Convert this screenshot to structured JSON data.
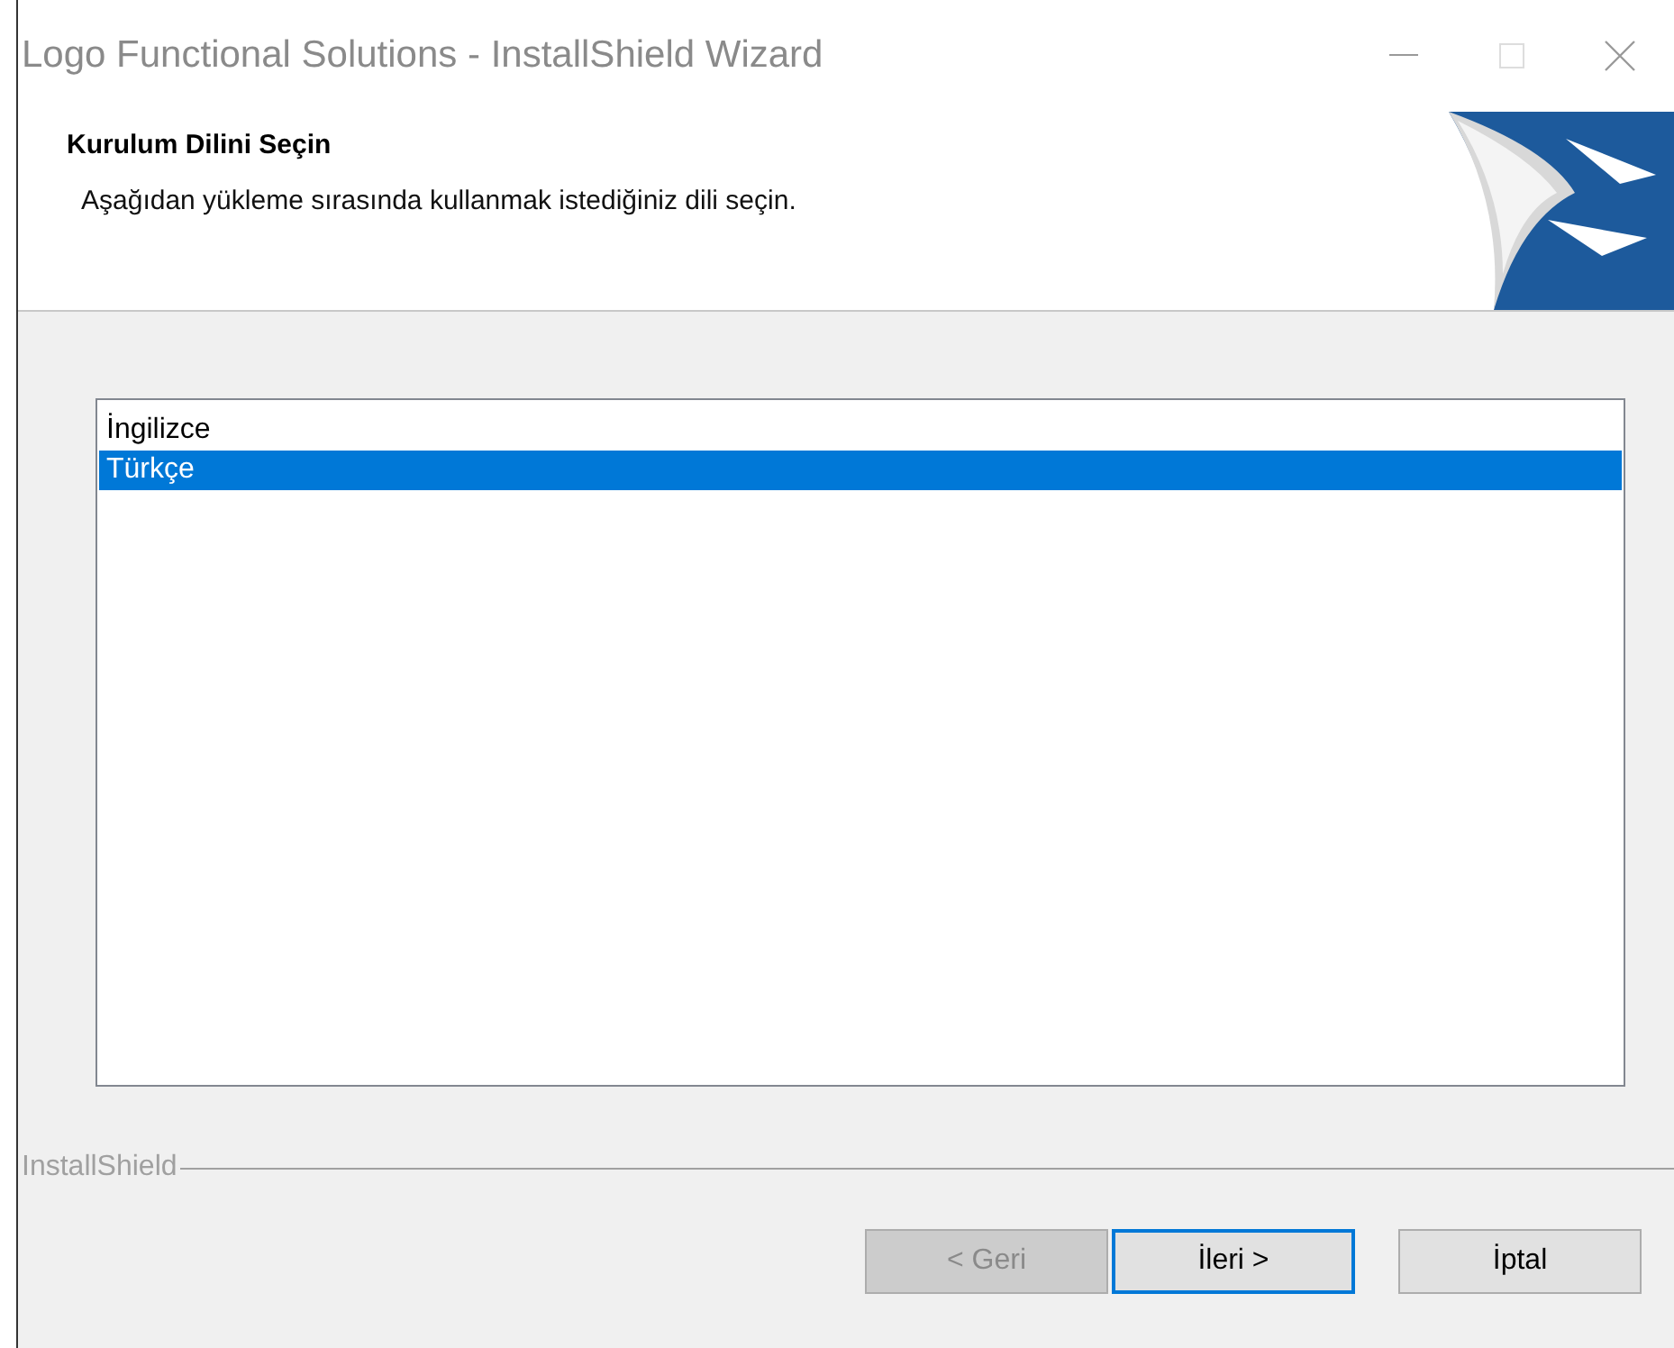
{
  "window": {
    "title": "Logo Functional Solutions - InstallShield Wizard"
  },
  "header": {
    "title": "Kurulum Dilini Seçin",
    "subtitle": "Aşağıdan yükleme sırasında kullanmak istediğiniz dili seçin."
  },
  "languages": [
    {
      "label": "İngilizce",
      "selected": false
    },
    {
      "label": "Türkçe",
      "selected": true
    }
  ],
  "brand_label": "InstallShield",
  "buttons": [
    {
      "label": "< Geri",
      "disabled": true,
      "focused": false
    },
    {
      "label": "İleri >",
      "disabled": false,
      "focused": true
    },
    {
      "label": "İptal",
      "disabled": false,
      "focused": false
    }
  ]
}
